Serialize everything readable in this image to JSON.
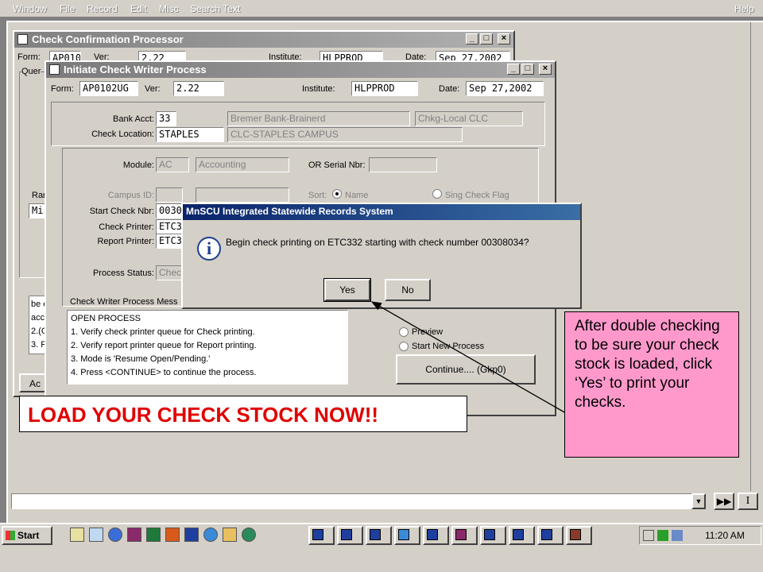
{
  "menubar": {
    "items": [
      "Window",
      "File",
      "Record",
      "Edit",
      "Misc",
      "Search Text"
    ],
    "help": "Help"
  },
  "back_window": {
    "title": "Check Confirmation Processor",
    "form_label": "Form:",
    "form_value": "AP0103UG",
    "ver_label": "Ver:",
    "ver_value": "2.22",
    "institute_label": "Institute:",
    "institute_value": "HLPPROD",
    "date_label": "Date:",
    "date_value": "Sep 27,2002",
    "group_label": "Quer",
    "range_label": "Ran",
    "range_value": "Mis",
    "msg_lines": [
      "be e",
      "acc",
      "2.(C",
      "3. F"
    ],
    "action_label": "Ac"
  },
  "front_window": {
    "title": "Initiate Check Writer Process",
    "form_label": "Form:",
    "form_value": "AP0102UG",
    "ver_label": "Ver:",
    "ver_value": "2.22",
    "institute_label": "Institute:",
    "institute_value": "HLPPROD",
    "date_label": "Date:",
    "date_value": "Sep 27,2002",
    "bank_acct_label": "Bank Acct:",
    "bank_acct_value": "33",
    "bank_name": "Bremer Bank-Brainerd",
    "bank_type": "Chkg-Local CLC",
    "check_location_label": "Check Location:",
    "check_location_value": "STAPLES",
    "check_location_desc": "CLC-STAPLES CAMPUS",
    "module_label": "Module:",
    "module_value": "AC",
    "module_desc": "Accounting",
    "or_serial_label": "OR Serial Nbr:",
    "campus_id_label": "Campus ID:",
    "sort_label": "Sort:",
    "sort_name": "Name",
    "sort_sing": "Sing Check Flag",
    "start_check_label": "Start Check Nbr:",
    "start_check_value": "0030",
    "check_printer_label": "Check Printer:",
    "check_printer_value": "ETC3",
    "report_printer_label": "Report Printer:",
    "report_printer_value": "ETC3",
    "process_status_label": "Process Status:",
    "process_status_value": "Check",
    "messages_label": "Check Writer Process Mess",
    "messages": [
      "OPEN PROCESS",
      "1. Verify check printer queue for Check printing.",
      "2. Verify report printer queue for Report printing.",
      "3. Mode is 'Resume Open/Pending.'",
      "4. Press <CONTINUE> to continue the process."
    ],
    "radio_preview": "Preview",
    "radio_new": "Start New Process",
    "continue_button": "Continue.... (Gkp0)"
  },
  "dialog": {
    "title": "MnSCU Integrated Statewide Records System",
    "message": "Begin check printing on ETC332 starting with check number 00308034?",
    "yes": "Yes",
    "no": "No"
  },
  "callout": {
    "text": "After double checking to be sure your check stock is loaded, click ‘Yes’ to print your checks."
  },
  "banner": {
    "text": "LOAD YOUR CHECK STOCK NOW!!"
  },
  "taskbar": {
    "start": "Start",
    "clock": "11:20 AM"
  }
}
